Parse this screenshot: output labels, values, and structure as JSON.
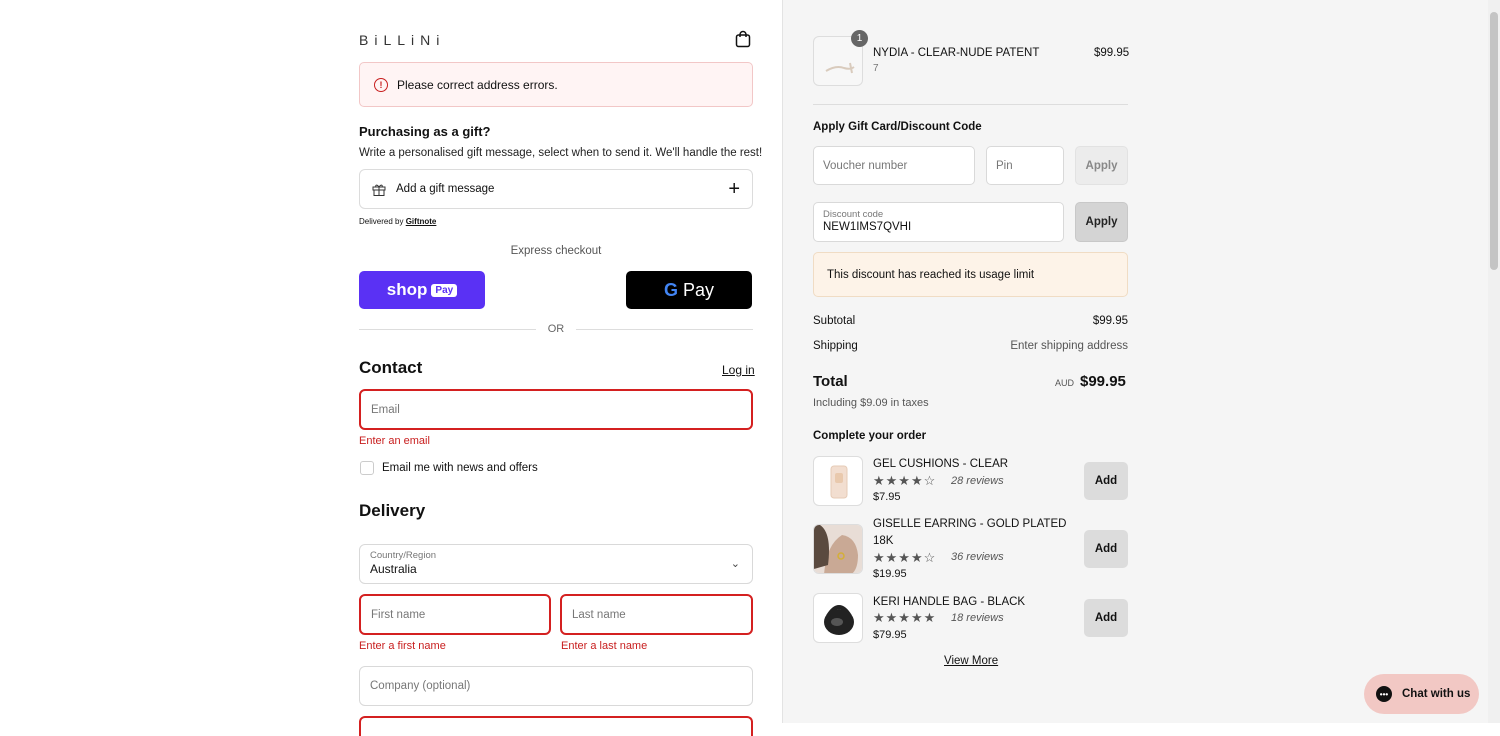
{
  "brand": "BiLLiNi",
  "error_banner": "Please correct address errors.",
  "gift": {
    "heading": "Purchasing as a gift?",
    "desc": "Write a personalised gift message, select when to send it. We'll handle the rest!",
    "add_label": "Add a gift message",
    "delivered_prefix": "Delivered by",
    "delivered_brand": "Giftnote"
  },
  "express": {
    "label": "Express checkout",
    "shop_label": "shop",
    "shop_pay": "Pay",
    "gpay_label": "Pay",
    "or": "OR"
  },
  "contact": {
    "heading": "Contact",
    "login": "Log in",
    "email_placeholder": "Email",
    "email_error": "Enter an email",
    "news_label": "Email me with news and offers"
  },
  "delivery": {
    "heading": "Delivery",
    "country_label": "Country/Region",
    "country_value": "Australia",
    "first_placeholder": "First name",
    "first_error": "Enter a first name",
    "last_placeholder": "Last name",
    "last_error": "Enter a last name",
    "company_placeholder": "Company (optional)"
  },
  "cart": {
    "item": {
      "name": "NYDIA - CLEAR-NUDE PATENT",
      "variant": "7",
      "price": "$99.95",
      "qty": "1"
    },
    "apply_heading": "Apply Gift Card/Discount Code",
    "voucher_placeholder": "Voucher number",
    "pin_placeholder": "Pin",
    "apply_label": "Apply",
    "discount_label": "Discount code",
    "discount_value": "NEW1IMS7QVHI",
    "discount_apply_label": "Apply",
    "discount_error": "This discount has reached its usage limit",
    "subtotal_label": "Subtotal",
    "subtotal_value": "$99.95",
    "shipping_label": "Shipping",
    "shipping_value": "Enter shipping address",
    "total_label": "Total",
    "currency": "AUD",
    "total_value": "$99.95",
    "tax_note": "Including $9.09 in taxes"
  },
  "upsell": {
    "heading": "Complete your order",
    "items": [
      {
        "name": "GEL CUSHIONS - CLEAR",
        "reviews": "28 reviews",
        "price": "$7.95",
        "add": "Add",
        "rating": 4.5
      },
      {
        "name": "GISELLE EARRING - GOLD PLATED",
        "name2": "18K",
        "reviews": "36 reviews",
        "price": "$19.95",
        "add": "Add",
        "rating": 4.5
      },
      {
        "name": "KERI HANDLE BAG - BLACK",
        "reviews": "18 reviews",
        "price": "$79.95",
        "add": "Add",
        "rating": 5
      }
    ],
    "view_more": "View More"
  },
  "chat": "Chat with us",
  "colors": {
    "error": "#c81e1e",
    "shop_pay": "#5a31f4",
    "warn_bg": "#fdf3e8"
  }
}
